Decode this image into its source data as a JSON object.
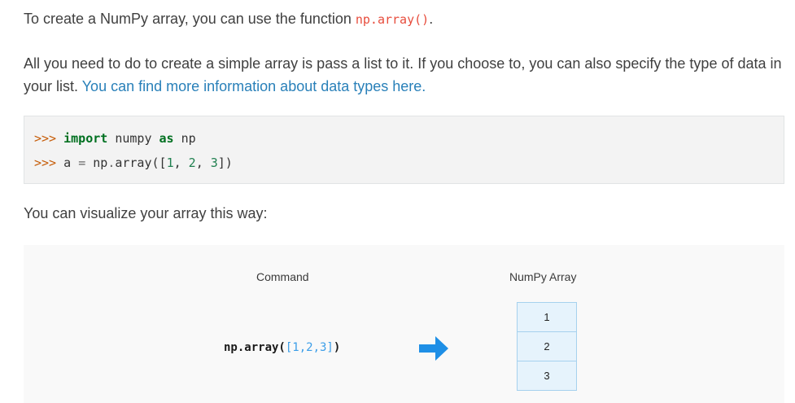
{
  "intro": {
    "text": "To create a NumPy array, you can use the function ",
    "code": "np.array()",
    "end": "."
  },
  "para2": {
    "text": "All you need to do to create a simple array is pass a list to it. If you choose to, you can also specify the type of data in your list. ",
    "link": "You can find more information about data types here."
  },
  "code_block": {
    "line1": {
      "prompt": ">>> ",
      "kw1": "import",
      "mod": " numpy ",
      "kw2": "as",
      "alias": " np"
    },
    "line2": {
      "prompt": ">>> ",
      "lhs": "a ",
      "eq": "=",
      "pre": " np",
      "dot": ".",
      "call": "array([",
      "n1": "1",
      "s1": ", ",
      "n2": "2",
      "s2": ", ",
      "n3": "3",
      "close": "])"
    }
  },
  "para3": "You can visualize your array this way:",
  "figure": {
    "command_heading": "Command",
    "array_heading": "NumPy Array",
    "command_code_fn": "np.array(",
    "command_code_arg": "[1,2,3]",
    "command_code_close": ")",
    "arrow_icon": "right-arrow-icon",
    "arrow_color": "#1e8fe6",
    "cells": [
      "1",
      "2",
      "3"
    ]
  }
}
